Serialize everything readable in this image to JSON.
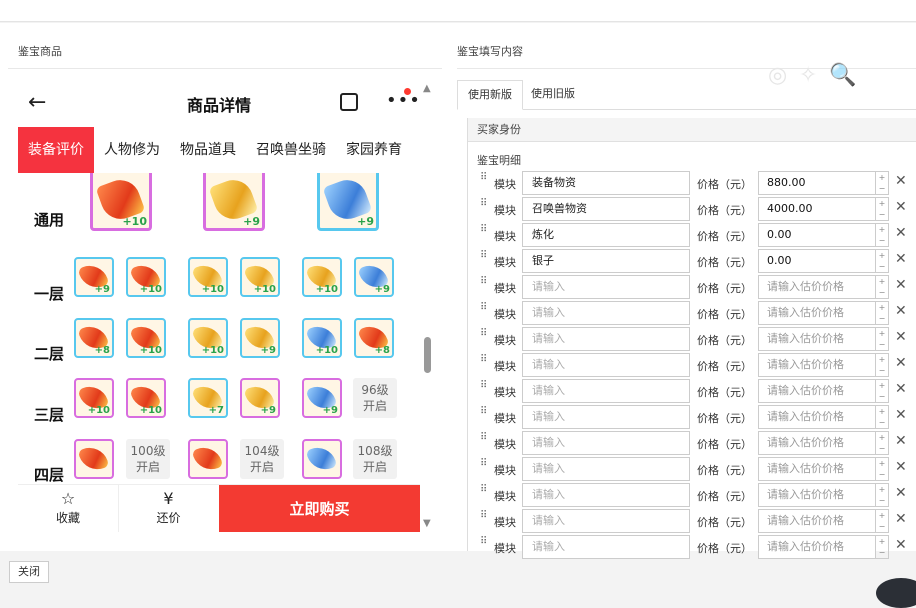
{
  "left_section_title": "鉴宝商品",
  "right_section_title": "鉴宝填写内容",
  "watermark": "◎ ✧ 🔍",
  "phone": {
    "title": "商品详情",
    "tabs": [
      "装备评价",
      "人物修为",
      "物品道具",
      "召唤兽坐骑",
      "家园养育"
    ],
    "active_tab": 0,
    "rows": [
      "通用",
      "一层",
      "二层",
      "三层",
      "四层"
    ],
    "common_items": [
      "+10",
      "+9",
      "+9"
    ],
    "layer1": [
      "+9",
      "+10",
      "+10",
      "+10",
      "+10",
      "+9"
    ],
    "layer2": [
      "+8",
      "+10",
      "+10",
      "+9",
      "+10",
      "+8"
    ],
    "layer3": [
      "+10",
      "+10",
      "+7",
      "+9",
      "+9"
    ],
    "layer3_lock": "96级\n开启",
    "layer4_locks": [
      "100级\n开启",
      "104级\n开启",
      "108级\n开启"
    ],
    "bottom": {
      "fav": "收藏",
      "bargain": "还价",
      "buy": "立即购买"
    }
  },
  "form": {
    "tabs": [
      "使用新版",
      "使用旧版"
    ],
    "buyer_label": "买家身份",
    "detail_label": "鉴宝明细",
    "module_label": "模块",
    "price_label": "价格（元）",
    "name_placeholder": "请输入",
    "price_placeholder": "请输入估价价格",
    "rows": [
      {
        "name": "装备物资",
        "price": "880.00"
      },
      {
        "name": "召唤兽物资",
        "price": "4000.00"
      },
      {
        "name": "炼化",
        "price": "0.00"
      },
      {
        "name": "银子",
        "price": "0.00"
      },
      {
        "name": "",
        "price": ""
      },
      {
        "name": "",
        "price": ""
      },
      {
        "name": "",
        "price": ""
      },
      {
        "name": "",
        "price": ""
      },
      {
        "name": "",
        "price": ""
      },
      {
        "name": "",
        "price": ""
      },
      {
        "name": "",
        "price": ""
      },
      {
        "name": "",
        "price": ""
      },
      {
        "name": "",
        "price": ""
      },
      {
        "name": "",
        "price": ""
      },
      {
        "name": "",
        "price": ""
      }
    ]
  },
  "close_button": "关闭"
}
